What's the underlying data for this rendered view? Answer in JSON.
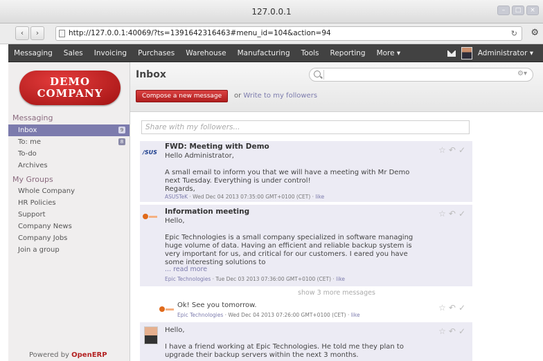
{
  "browser": {
    "title": "127.0.0.1",
    "url": "http://127.0.0.1:40069/?ts=1391642316463#menu_id=104&action=94"
  },
  "appnav": {
    "items": [
      "Messaging",
      "Sales",
      "Invoicing",
      "Purchases",
      "Warehouse",
      "Manufacturing",
      "Tools",
      "Reporting",
      "More ▾"
    ],
    "user": "Administrator ▾"
  },
  "sidebar": {
    "logo_line1": "DEMO",
    "logo_line2": "COMPANY",
    "section1": "Messaging",
    "items": [
      {
        "label": "Inbox",
        "badge": "9"
      },
      {
        "label": "To: me",
        "badge": "8"
      },
      {
        "label": "To-do"
      },
      {
        "label": "Archives"
      }
    ],
    "section2": "My Groups",
    "groups": [
      "Whole Company",
      "HR Policies",
      "Support",
      "Company News",
      "Company Jobs",
      "Join a group"
    ],
    "powered_prefix": "Powered by ",
    "powered_brand": "OpenERP"
  },
  "main": {
    "title": "Inbox",
    "compose": "Compose a new message",
    "or_text": "or ",
    "write_followers": "Write to my followers",
    "share_placeholder": "Share with my followers...",
    "show_more": "show 3 more messages"
  },
  "messages": [
    {
      "icon": "asus-logo",
      "logo_text": "/SUS",
      "subject": "FWD: Meeting with Demo",
      "body": "Hello Administrator,\n\nA small email to inform you that we will have a meeting with Mr Demo\nnext Tuesday. Everything is under control!\nRegards,",
      "author": "ASUSTeK",
      "date": " · Wed Dec 04 2013 07:35:00 GMT+0100 (CET) · ",
      "like": "like"
    },
    {
      "icon": "epic-logo",
      "subject": "Information meeting",
      "body": "Hello,\n\nEpic Technologies is a small company specialized in software managing\nhuge volume of data. Having an efficient and reliable backup system is\nvery important for us, and critical for our customers. I eared you have\nsome interesting solutions to",
      "read_more": "... read more",
      "author": "Epic Technologies",
      "date": " · Tue Dec 03 2013 07:36:00 GMT+0100 (CET) · ",
      "like": "like"
    },
    {
      "icon": "epic-logo",
      "body": "Ok! See you tomorrow.",
      "author": "Epic Technologies",
      "date": " · Wed Dec 04 2013 07:26:00 GMT+0100 (CET) · ",
      "like": "like"
    },
    {
      "icon": "person-avatar",
      "body": "Hello,\n\nI have a friend working at Epic Technologies. He told me they plan to\nupgrade their backup servers within the next 3 months."
    }
  ]
}
